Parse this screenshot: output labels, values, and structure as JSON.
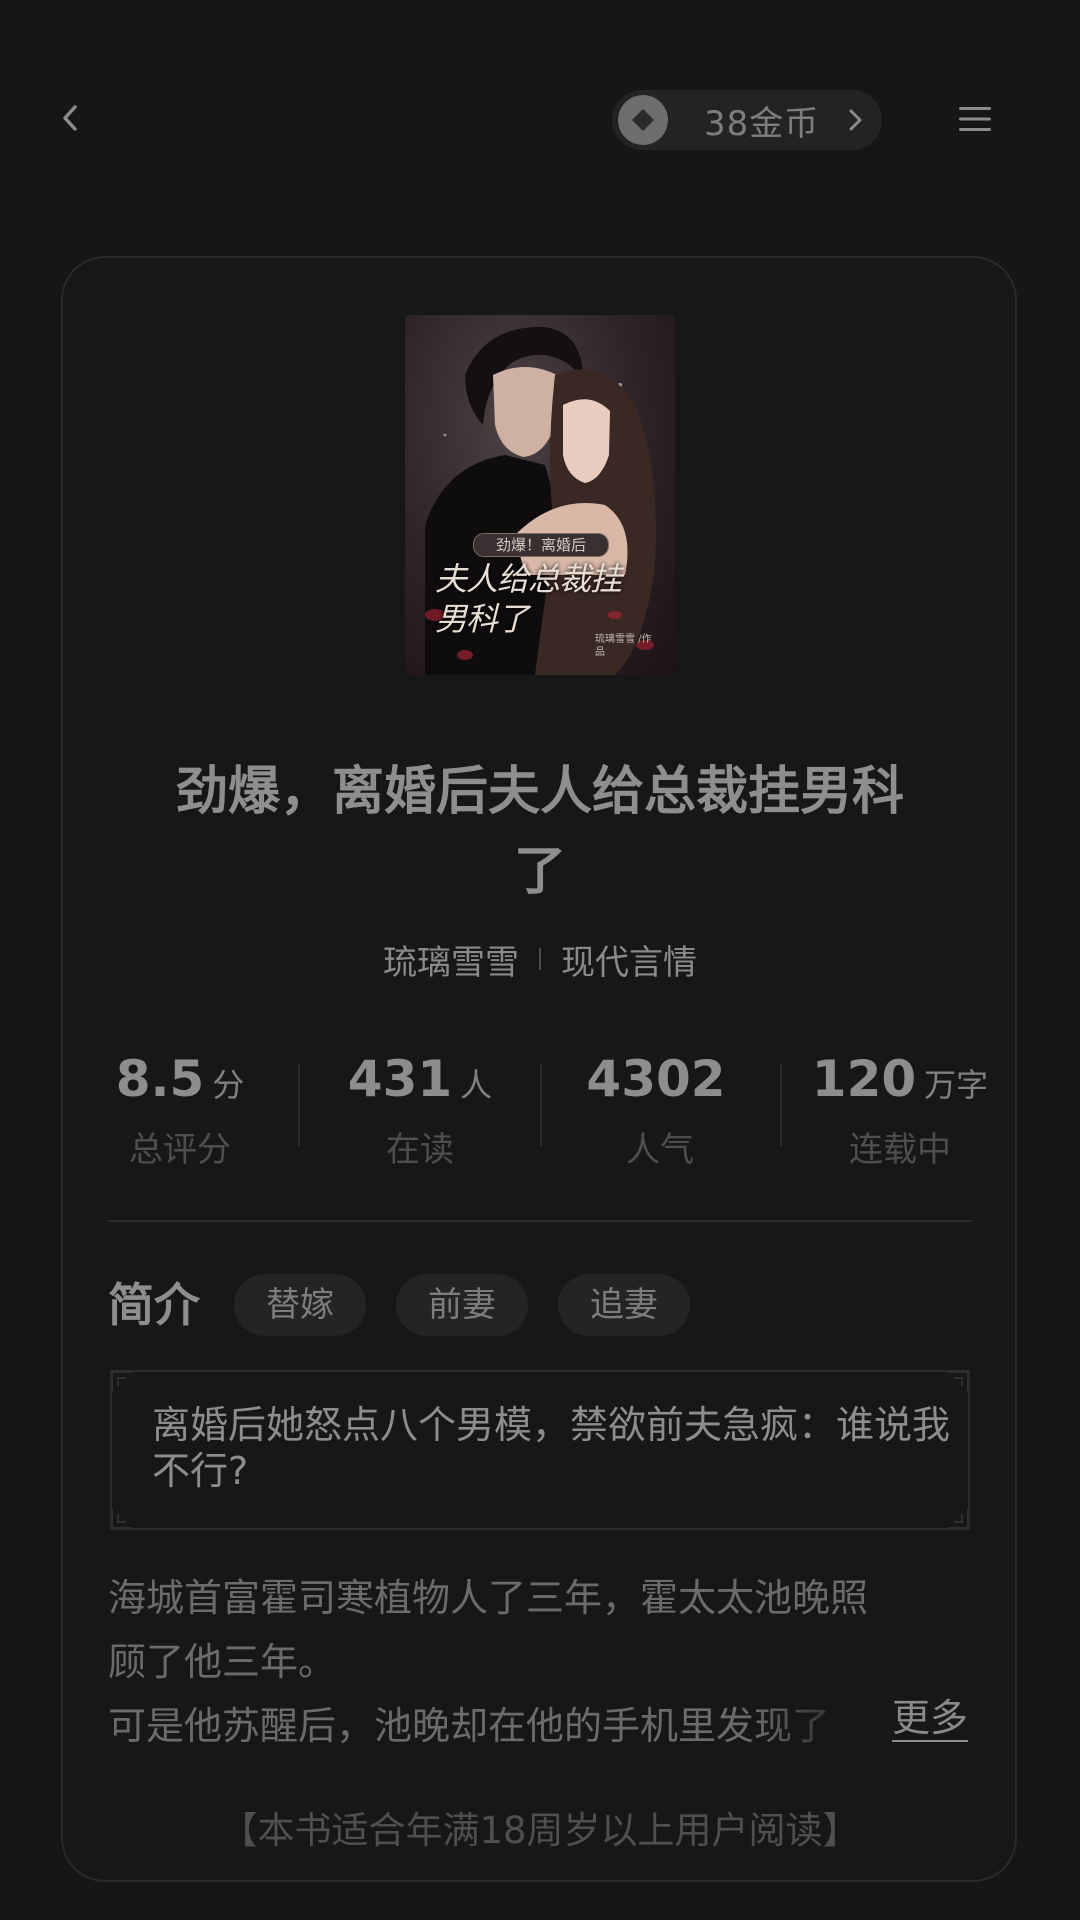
{
  "header": {
    "coins_label": "38金币"
  },
  "book": {
    "cover": {
      "tagline": "劲爆！离婚后",
      "title_art": "夫人给总裁挂男科了",
      "author_art": "琉璃雪雪 /作品"
    },
    "title": "劲爆，离婚后夫人给总裁挂男科了",
    "author": "琉璃雪雪",
    "genre": "现代言情"
  },
  "stats": [
    {
      "value": "8.5",
      "unit": "分",
      "label": "总评分"
    },
    {
      "value": "431",
      "unit": "人",
      "label": "在读"
    },
    {
      "value": "4302",
      "unit": "",
      "label": "人气"
    },
    {
      "value": "120",
      "unit": "万字",
      "label": "连载中"
    }
  ],
  "intro": {
    "heading": "简介",
    "tags": [
      "替嫁",
      "前妻",
      "追妻"
    ],
    "quote": "离婚后她怒点八个男模，禁欲前夫急疯：谁说我不行?",
    "desc_lines": [
      "海城首富霍司寒植物人了三年，霍太太池晚照",
      "顾了他三年。",
      "可是他苏醒后，池晚却在他的手机里发现了"
    ],
    "more_label": "更多"
  },
  "age_note": "【本书适合年满18周岁以上用户阅读】",
  "colors": {
    "background": "#161616",
    "card_border": "#2a2a2a",
    "text_primary": "#8e8e8e",
    "text_muted": "#4e4e4e"
  }
}
